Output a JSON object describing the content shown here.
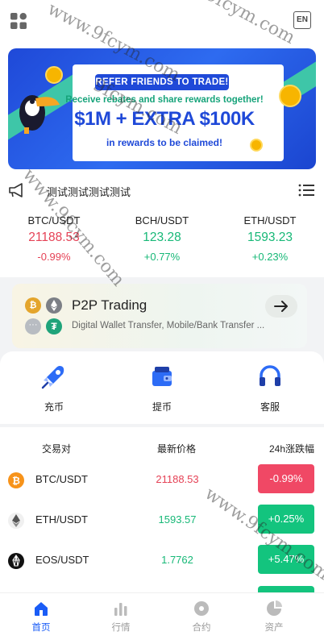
{
  "topbar": {
    "lang_label": "EN"
  },
  "banner": {
    "line1": "REFER FRIENDS TO TRADE!",
    "line2": "Receive rebates and share rewards together!",
    "line3": "$1M + EXTRA $100K",
    "line4": "in rewards to be claimed!"
  },
  "notice": {
    "text": "测试测试测试测试"
  },
  "tickers": [
    {
      "pair": "BTC/USDT",
      "price": "21188.53",
      "change": "-0.99%",
      "trend": "down"
    },
    {
      "pair": "BCH/USDT",
      "price": "123.28",
      "change": "+0.77%",
      "trend": "up"
    },
    {
      "pair": "ETH/USDT",
      "price": "1593.23",
      "change": "+0.23%",
      "trend": "up"
    }
  ],
  "p2p": {
    "title": "P2P Trading",
    "subtitle": "Digital Wallet Transfer, Mobile/Bank Transfer ..."
  },
  "quick_actions": [
    {
      "label": "充币",
      "icon": "rocket-icon"
    },
    {
      "label": "提币",
      "icon": "wallet-icon"
    },
    {
      "label": "客服",
      "icon": "headset-icon"
    }
  ],
  "market": {
    "headers": {
      "pair": "交易对",
      "price": "最新价格",
      "change": "24h涨跌幅"
    },
    "rows": [
      {
        "pair": "BTC/USDT",
        "price": "21188.53",
        "change": "-0.99%",
        "trend": "down",
        "icon": "btc-icon"
      },
      {
        "pair": "ETH/USDT",
        "price": "1593.57",
        "change": "+0.25%",
        "trend": "up",
        "icon": "eth-icon"
      },
      {
        "pair": "EOS/USDT",
        "price": "1.7762",
        "change": "+5.47%",
        "trend": "up",
        "icon": "eos-icon"
      }
    ]
  },
  "tabbar": [
    {
      "label": "首页",
      "icon": "home-icon",
      "active": true
    },
    {
      "label": "行情",
      "icon": "chart-icon",
      "active": false
    },
    {
      "label": "合约",
      "icon": "contract-icon",
      "active": false
    },
    {
      "label": "资产",
      "icon": "pie-icon",
      "active": false
    }
  ],
  "colors": {
    "up": "#17b877",
    "down": "#e54256",
    "accent": "#1a5cf6"
  },
  "watermarks": [
    "www.9fcym.com",
    "9fcym.com",
    "www.9fcym.com",
    "www.9fcym.com",
    "9fcym.com"
  ]
}
